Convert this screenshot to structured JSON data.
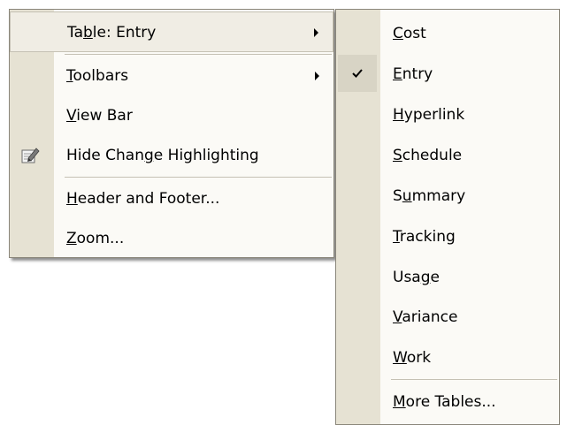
{
  "main_menu": {
    "items": [
      {
        "label": "Table: Entry",
        "accelerator": "b",
        "has_submenu": true,
        "selected": true
      },
      {
        "label": "Toolbars",
        "accelerator": "T",
        "has_submenu": true
      },
      {
        "label": "View Bar",
        "accelerator": "V"
      },
      {
        "label": "Hide Change Highlighting",
        "accelerator": "g",
        "icon": "edit-highlight-icon"
      },
      {
        "label": "Header and Footer...",
        "accelerator": "H"
      },
      {
        "label": "Zoom...",
        "accelerator": "Z"
      }
    ]
  },
  "table_submenu": {
    "items": [
      {
        "label": "Cost",
        "accelerator": "C"
      },
      {
        "label": "Entry",
        "accelerator": "E",
        "checked": true
      },
      {
        "label": "Hyperlink",
        "accelerator": "H"
      },
      {
        "label": "Schedule",
        "accelerator": "S"
      },
      {
        "label": "Summary",
        "accelerator": "u"
      },
      {
        "label": "Tracking",
        "accelerator": "T"
      },
      {
        "label": "Usage",
        "accelerator": "g"
      },
      {
        "label": "Variance",
        "accelerator": "V"
      },
      {
        "label": "Work",
        "accelerator": "W"
      },
      {
        "label": "More Tables...",
        "accelerator": "M"
      }
    ],
    "check_icon": "checkmark-icon"
  }
}
